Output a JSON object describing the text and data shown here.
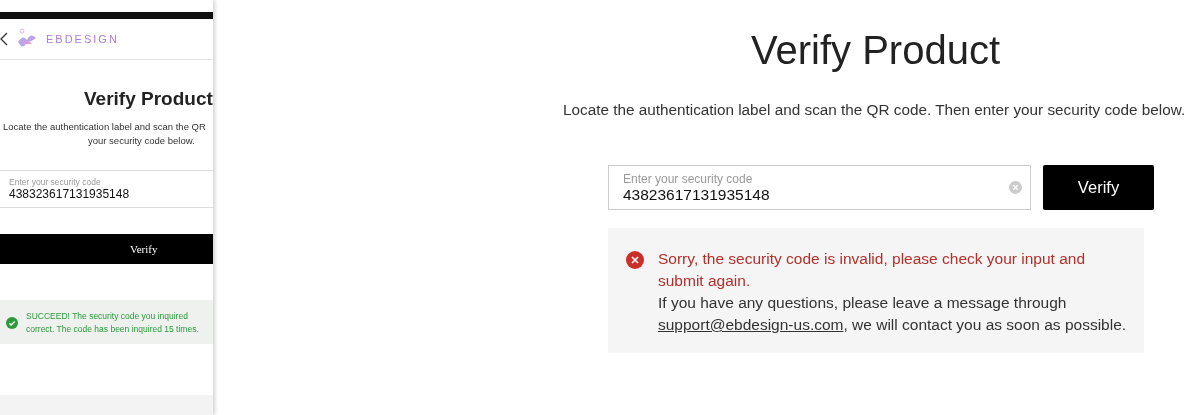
{
  "mobile": {
    "brand": "EBDESIGN",
    "title": "Verify Product",
    "instructions": [
      "Locate the authentication label and scan the QR",
      "your security code below."
    ],
    "field": {
      "label": "Enter your security code",
      "value": "438323617131935148"
    },
    "button": "Verify",
    "message": {
      "kind": "success",
      "lines": [
        "SUCCEED! The security code you inquired",
        "correct. The code has been inquired 15 times."
      ]
    }
  },
  "desktop": {
    "title": "Verify Product",
    "instructions": "Locate the authentication label and scan the QR code. Then enter your security code below.",
    "field": {
      "label": "Enter your security code",
      "value": "43823617131935148"
    },
    "button": "Verify",
    "message": {
      "kind": "error",
      "error": "Sorry, the security code is invalid, please check your input and submit again.",
      "help": "If you have any questions, please leave a message through",
      "email": "support@ebdesign-us.com",
      "help_end": ", we will contact you as soon as possible."
    }
  }
}
